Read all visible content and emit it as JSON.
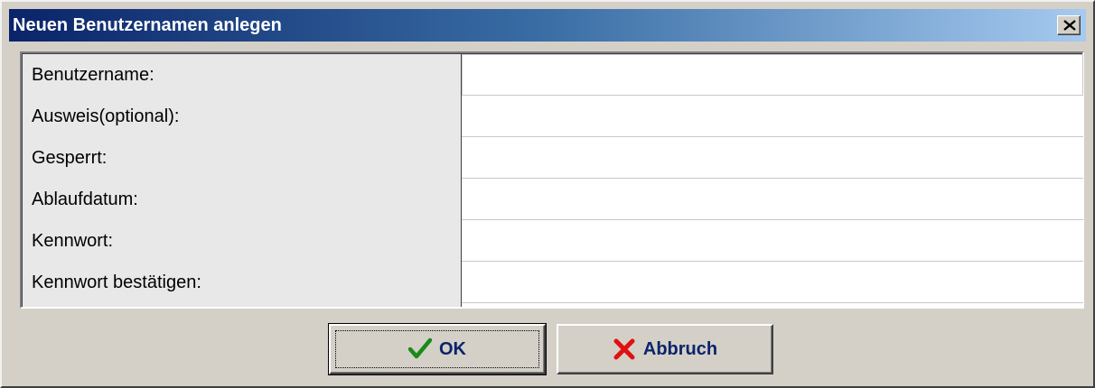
{
  "window": {
    "title": "Neuen Benutzernamen anlegen",
    "close_icon": "close-x-icon"
  },
  "form": {
    "fields": [
      {
        "label": "Benutzername:",
        "value": ""
      },
      {
        "label": "Ausweis(optional):",
        "value": ""
      },
      {
        "label": "Gesperrt:",
        "value": ""
      },
      {
        "label": "Ablaufdatum:",
        "value": ""
      },
      {
        "label": "Kennwort:",
        "value": ""
      },
      {
        "label": "Kennwort bestätigen:",
        "value": ""
      }
    ]
  },
  "buttons": {
    "ok": {
      "label": "OK",
      "icon": "checkmark-icon",
      "icon_color": "#1a8a1a"
    },
    "cancel": {
      "label": "Abbruch",
      "icon": "red-x-icon",
      "icon_color": "#e01010"
    }
  },
  "colors": {
    "titlebar_start": "#0a246a",
    "titlebar_end": "#a6caf0",
    "dialog_bg": "#d4d0c8",
    "button_text": "#0a246a"
  }
}
